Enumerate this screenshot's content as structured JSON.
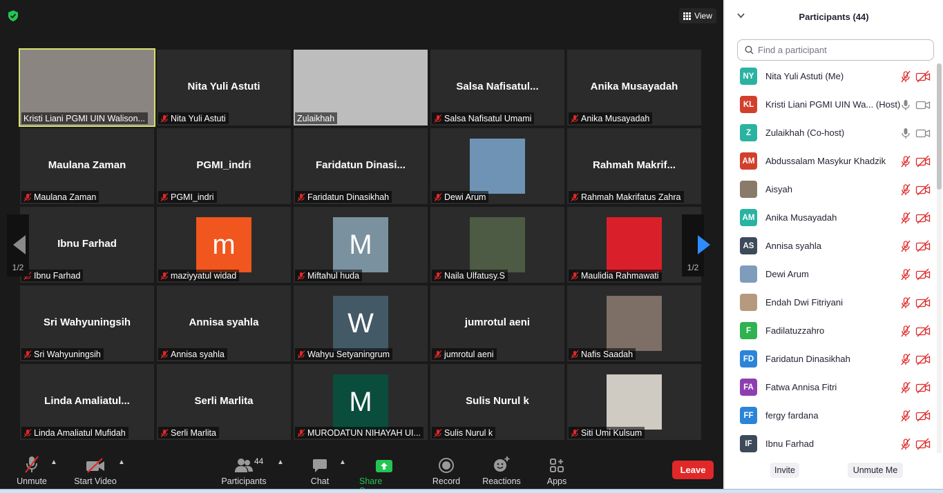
{
  "top": {
    "view_label": "View"
  },
  "tiles": [
    {
      "id": "t1",
      "name": "",
      "label": "Kristi Liani PGMI UIN Walison...",
      "muted": false,
      "kind": "video",
      "active": true,
      "bg": "#8a8580"
    },
    {
      "id": "t2",
      "name": "Nita Yuli Astuti",
      "label": "Nita Yuli Astuti",
      "muted": true,
      "kind": "name"
    },
    {
      "id": "t3",
      "name": "",
      "label": "Zulaikhah",
      "muted": false,
      "kind": "video",
      "bg": "#bdbdbd"
    },
    {
      "id": "t4",
      "name": "Salsa  Nafisatul...",
      "label": "Salsa Nafisatul Umami",
      "muted": true,
      "kind": "name"
    },
    {
      "id": "t5",
      "name": "Anika Musayadah",
      "label": "Anika Musayadah",
      "muted": true,
      "kind": "name"
    },
    {
      "id": "t6",
      "name": "Maulana Zaman",
      "label": "Maulana Zaman",
      "muted": true,
      "kind": "name"
    },
    {
      "id": "t7",
      "name": "PGMI_indri",
      "label": "PGMI_indri",
      "muted": true,
      "kind": "name"
    },
    {
      "id": "t8",
      "name": "Faridatun  Dinasi...",
      "label": "Faridatun Dinasikhah",
      "muted": true,
      "kind": "name"
    },
    {
      "id": "t9",
      "name": "",
      "label": "Dewi Arum",
      "muted": true,
      "kind": "photo",
      "bg": "#6f93b5"
    },
    {
      "id": "t10",
      "name": "Rahmah  Makrif...",
      "label": "Rahmah Makrifatus Zahra",
      "muted": true,
      "kind": "name"
    },
    {
      "id": "t11",
      "name": "Ibnu Farhad",
      "label": "Ibnu Farhad",
      "muted": true,
      "kind": "name"
    },
    {
      "id": "t12",
      "name": "",
      "label": "maziyyatul widad",
      "muted": true,
      "kind": "avatar",
      "letter": "m",
      "bg": "#f0561d"
    },
    {
      "id": "t13",
      "name": "",
      "label": "Miftahul huda",
      "muted": true,
      "kind": "avatar",
      "letter": "M",
      "bg": "#7a929f"
    },
    {
      "id": "t14",
      "name": "",
      "label": "Naila Ulfatusy.S",
      "muted": true,
      "kind": "photo",
      "bg": "#4d5a44"
    },
    {
      "id": "t15",
      "name": "",
      "label": "Maulidia Rahmawati",
      "muted": true,
      "kind": "photo",
      "bg": "#d9202a"
    },
    {
      "id": "t16",
      "name": "Sri Wahyuningsih",
      "label": "Sri Wahyuningsih",
      "muted": true,
      "kind": "name"
    },
    {
      "id": "t17",
      "name": "Annisa syahla",
      "label": "Annisa syahla",
      "muted": true,
      "kind": "name"
    },
    {
      "id": "t18",
      "name": "",
      "label": "Wahyu Setyaningrum",
      "muted": true,
      "kind": "avatar",
      "letter": "W",
      "bg": "#435966"
    },
    {
      "id": "t19",
      "name": "jumrotul aeni",
      "label": "jumrotul aeni",
      "muted": true,
      "kind": "name"
    },
    {
      "id": "t20",
      "name": "",
      "label": "Nafis Saadah",
      "muted": true,
      "kind": "photo",
      "bg": "#7d6e66"
    },
    {
      "id": "t21",
      "name": "Linda  Amaliatul...",
      "label": "Linda Amaliatul Mufidah",
      "muted": true,
      "kind": "name"
    },
    {
      "id": "t22",
      "name": "Serli Marlita",
      "label": "Serli Marlita",
      "muted": true,
      "kind": "name"
    },
    {
      "id": "t23",
      "name": "",
      "label": "MURODATUN NIHAYAH UI...",
      "muted": true,
      "kind": "avatar",
      "letter": "M",
      "bg": "#0b4d3d"
    },
    {
      "id": "t24",
      "name": "Sulis Nurul k",
      "label": "Sulis Nurul k",
      "muted": true,
      "kind": "name"
    },
    {
      "id": "t25",
      "name": "",
      "label": "Siti Umi Kulsum",
      "muted": true,
      "kind": "photo",
      "bg": "#cfcac2"
    }
  ],
  "pager": {
    "left": "1/2",
    "right": "1/2"
  },
  "toolbar": {
    "unmute": "Unmute",
    "start_video": "Start Video",
    "participants": "Participants",
    "participants_count": "44",
    "chat": "Chat",
    "share_screen": "Share Screen",
    "record": "Record",
    "reactions": "Reactions",
    "apps": "Apps",
    "leave": "Leave"
  },
  "panel": {
    "title": "Participants (44)",
    "search_placeholder": "Find a participant",
    "invite": "Invite",
    "unmute_me": "Unmute Me",
    "participants": [
      {
        "initials": "NY",
        "name": "Nita Yuli Astuti (Me)",
        "color": "#2ab3a1",
        "mic": "muted",
        "cam": "off"
      },
      {
        "initials": "KL",
        "name": "Kristi Liani PGMI UIN Wa... (Host)",
        "color": "#d2402c",
        "mic": "on",
        "cam": "on"
      },
      {
        "initials": "Z",
        "name": "Zulaikhah (Co-host)",
        "color": "#2ab3a1",
        "mic": "on",
        "cam": "on"
      },
      {
        "initials": "AM",
        "name": "Abdussalam Masykur Khadzik",
        "color": "#d2402c",
        "mic": "muted",
        "cam": "off"
      },
      {
        "initials": "",
        "name": "Aisyah",
        "color": "#8a7a6a",
        "mic": "muted",
        "cam": "off",
        "photo": true
      },
      {
        "initials": "AM",
        "name": "Anika Musayadah",
        "color": "#2ab3a1",
        "mic": "muted",
        "cam": "off"
      },
      {
        "initials": "AS",
        "name": "Annisa syahla",
        "color": "#3c4a5a",
        "mic": "muted",
        "cam": "off"
      },
      {
        "initials": "",
        "name": "Dewi Arum",
        "color": "#7f9cbc",
        "mic": "muted",
        "cam": "off",
        "photo": true
      },
      {
        "initials": "",
        "name": "Endah Dwi Fitriyani",
        "color": "#b59a7e",
        "mic": "muted",
        "cam": "off",
        "photo": true
      },
      {
        "initials": "F",
        "name": "Fadilatuzzahro",
        "color": "#2fb351",
        "mic": "muted",
        "cam": "off"
      },
      {
        "initials": "FD",
        "name": "Faridatun Dinasikhah",
        "color": "#2c84d8",
        "mic": "muted",
        "cam": "off"
      },
      {
        "initials": "FA",
        "name": "Fatwa Annisa Fitri",
        "color": "#8d3fb0",
        "mic": "muted",
        "cam": "off"
      },
      {
        "initials": "FF",
        "name": "fergy fardana",
        "color": "#2c84d8",
        "mic": "muted",
        "cam": "off"
      },
      {
        "initials": "IF",
        "name": "Ibnu Farhad",
        "color": "#3c4a5a",
        "mic": "muted",
        "cam": "off"
      }
    ]
  }
}
